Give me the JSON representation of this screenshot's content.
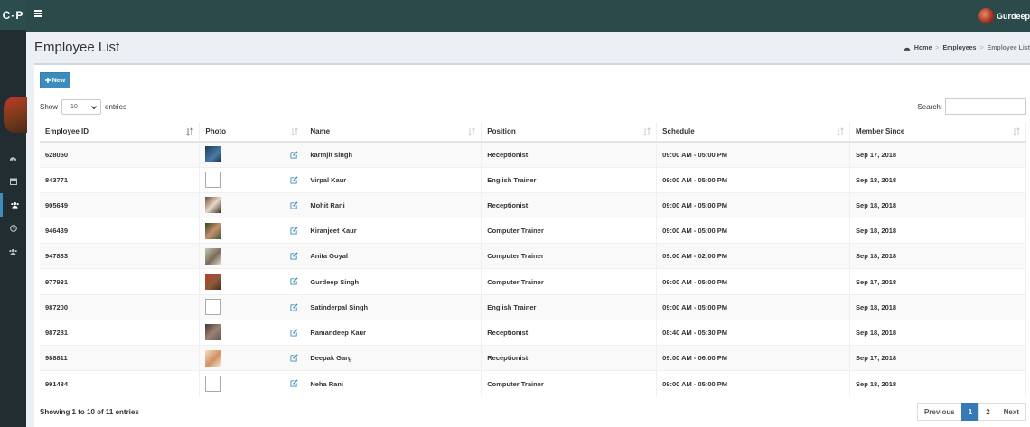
{
  "app": {
    "logo": "C-P"
  },
  "topbar": {
    "user_name": "Gurdeep"
  },
  "page": {
    "title": "Employee List"
  },
  "breadcrumb": {
    "home": "Home",
    "employees": "Employees",
    "current": "Employee List"
  },
  "toolbar": {
    "new_label": "New"
  },
  "length_menu": {
    "show": "Show",
    "value": "10",
    "entries": "entries"
  },
  "search": {
    "label": "Search:",
    "value": ""
  },
  "table": {
    "headers": [
      "Employee ID",
      "Photo",
      "Name",
      "Position",
      "Schedule",
      "Member Since"
    ],
    "rows": [
      {
        "id": "628050",
        "name": "karmjit singh",
        "position": "Receptionist",
        "schedule": "09:00 AM - 05:00 PM",
        "since": "Sep 17, 2018"
      },
      {
        "id": "843771",
        "name": "Virpal Kaur",
        "position": "English Trainer",
        "schedule": "09:00 AM - 05:00 PM",
        "since": "Sep 18, 2018"
      },
      {
        "id": "905649",
        "name": "Mohit Rani",
        "position": "Receptionist",
        "schedule": "09:00 AM - 05:00 PM",
        "since": "Sep 18, 2018"
      },
      {
        "id": "946439",
        "name": "Kiranjeet Kaur",
        "position": "Computer Trainer",
        "schedule": "09:00 AM - 05:00 PM",
        "since": "Sep 18, 2018"
      },
      {
        "id": "947833",
        "name": "Anita Goyal",
        "position": "Computer Trainer",
        "schedule": "09:00 AM - 02:00 PM",
        "since": "Sep 18, 2018"
      },
      {
        "id": "977931",
        "name": "Gurdeep Singh",
        "position": "Computer Trainer",
        "schedule": "09:00 AM - 05:00 PM",
        "since": "Sep 17, 2018"
      },
      {
        "id": "987200",
        "name": "Satinderpal Singh",
        "position": "English Trainer",
        "schedule": "09:00 AM - 05:00 PM",
        "since": "Sep 18, 2018"
      },
      {
        "id": "987281",
        "name": "Ramandeep Kaur",
        "position": "Receptionist",
        "schedule": "08:40 AM - 05:30 PM",
        "since": "Sep 18, 2018"
      },
      {
        "id": "988811",
        "name": "Deepak Garg",
        "position": "Receptionist",
        "schedule": "09:00 AM - 06:00 PM",
        "since": "Sep 17, 2018"
      },
      {
        "id": "991484",
        "name": "Neha Rani",
        "position": "Computer Trainer",
        "schedule": "09:00 AM - 05:00 PM",
        "since": "Sep 18, 2018"
      }
    ]
  },
  "footer": {
    "info": "Showing 1 to 10 of 11 entries"
  },
  "pagination": {
    "previous": "Previous",
    "page1": "1",
    "page2": "2",
    "next": "Next"
  },
  "colors": {
    "sidebar": "#222d32",
    "topbar": "#2c4a4a",
    "accent": "#3c8dbc",
    "active_page": "#337ab7"
  },
  "icons": {
    "sidebar": [
      "dashboard-icon",
      "calendar-icon",
      "users-icon",
      "clock-icon",
      "group-icon"
    ],
    "row_action": "edit-icon"
  }
}
